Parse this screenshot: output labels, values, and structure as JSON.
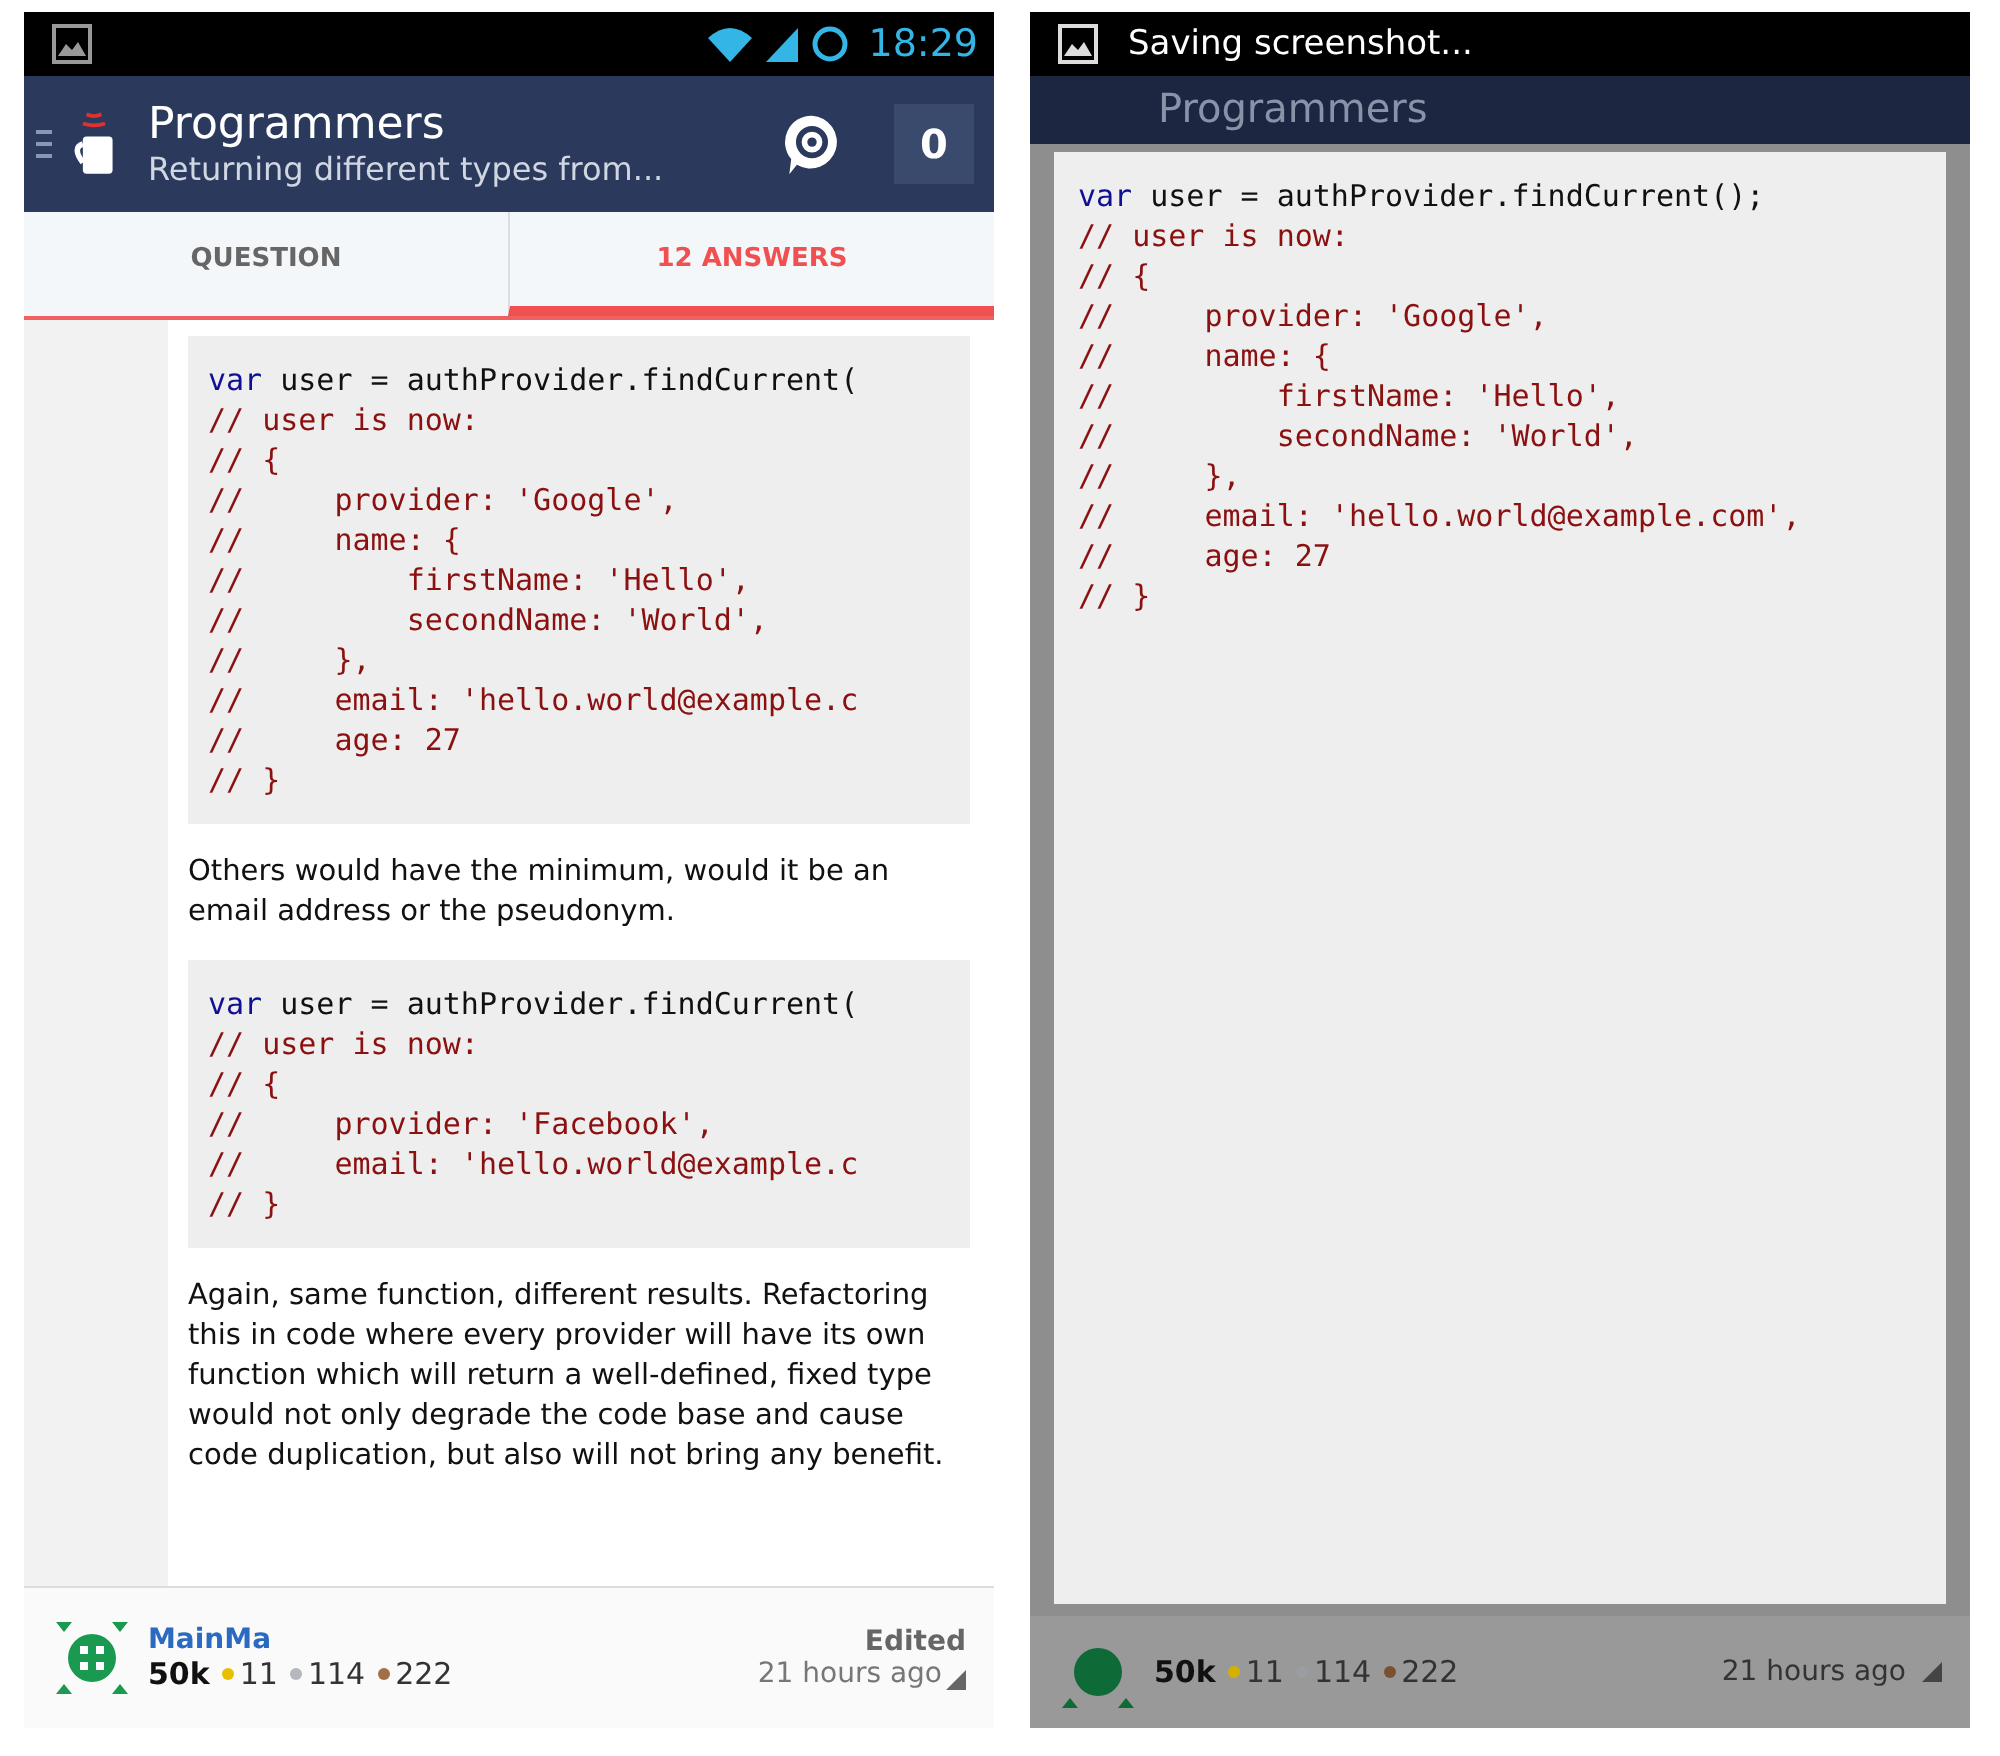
{
  "left_screen": {
    "status_bar": {
      "time": "18:29"
    },
    "header": {
      "title": "Programmers",
      "subtitle": "Returning different types from...",
      "count": "0"
    },
    "tabs": [
      {
        "label": "QUESTION",
        "selected": false
      },
      {
        "label": "12 ANSWERS",
        "selected": true
      }
    ],
    "content": [
      {
        "kind": "code",
        "lines": [
          [
            {
              "kind": "keyword",
              "text": "var"
            },
            {
              "kind": "plain",
              "text": " user = authProvider.findCurrent("
            }
          ],
          [
            {
              "kind": "comment",
              "text": "// user is now:"
            }
          ],
          [
            {
              "kind": "comment",
              "text": "// {"
            }
          ],
          [
            {
              "kind": "comment",
              "text": "//     provider: 'Google',"
            }
          ],
          [
            {
              "kind": "comment",
              "text": "//     name: {"
            }
          ],
          [
            {
              "kind": "comment",
              "text": "//         firstName: 'Hello',"
            }
          ],
          [
            {
              "kind": "comment",
              "text": "//         secondName: 'World',"
            }
          ],
          [
            {
              "kind": "comment",
              "text": "//     },"
            }
          ],
          [
            {
              "kind": "comment",
              "text": "//     email: 'hello.world@example.c"
            }
          ],
          [
            {
              "kind": "comment",
              "text": "//     age: 27"
            }
          ],
          [
            {
              "kind": "comment",
              "text": "// }"
            }
          ]
        ]
      },
      {
        "kind": "text",
        "text": "Others would have the minimum, would it be an email address or the pseudonym."
      },
      {
        "kind": "code",
        "lines": [
          [
            {
              "kind": "keyword",
              "text": "var"
            },
            {
              "kind": "plain",
              "text": " user = authProvider.findCurrent("
            }
          ],
          [
            {
              "kind": "comment",
              "text": "// user is now:"
            }
          ],
          [
            {
              "kind": "comment",
              "text": "// {"
            }
          ],
          [
            {
              "kind": "comment",
              "text": "//     provider: 'Facebook',"
            }
          ],
          [
            {
              "kind": "comment",
              "text": "//     email: 'hello.world@example.c"
            }
          ],
          [
            {
              "kind": "comment",
              "text": "// }"
            }
          ]
        ]
      },
      {
        "kind": "text",
        "text": "Again, same function, different results. Refactoring this in code where every provider will have its own function which will return a well-defined, fixed type would not only degrade the code base and cause code duplication, but also will not bring any benefit."
      }
    ],
    "footer": {
      "user": "MainMa",
      "reputation": "50k",
      "badges": [
        {
          "color": "#e6c000",
          "count": "11"
        },
        {
          "color": "#b4b8bc",
          "count": "114"
        },
        {
          "color": "#a0704a",
          "count": "222"
        }
      ],
      "edited": "Edited",
      "time": "21 hours ago"
    }
  },
  "right_screen": {
    "status_bar": {
      "notification": "Saving screenshot..."
    },
    "header": {
      "title": "Programmers"
    },
    "screenshot_preview": {
      "lines": [
        [
          {
            "kind": "keyword",
            "text": "var"
          },
          {
            "kind": "plain",
            "text": " user = authProvider.findCurrent();"
          }
        ],
        [
          {
            "kind": "comment",
            "text": "// user is now:"
          }
        ],
        [
          {
            "kind": "comment",
            "text": "// {"
          }
        ],
        [
          {
            "kind": "comment",
            "text": "//     provider: 'Google',"
          }
        ],
        [
          {
            "kind": "comment",
            "text": "//     name: {"
          }
        ],
        [
          {
            "kind": "comment",
            "text": "//         firstName: 'Hello',"
          }
        ],
        [
          {
            "kind": "comment",
            "text": "//         secondName: 'World',"
          }
        ],
        [
          {
            "kind": "comment",
            "text": "//     },"
          }
        ],
        [
          {
            "kind": "comment",
            "text": "//     email: 'hello.world@example.com',"
          }
        ],
        [
          {
            "kind": "comment",
            "text": "//     age: 27"
          }
        ],
        [
          {
            "kind": "comment",
            "text": "// }"
          }
        ]
      ]
    },
    "footer": {
      "reputation": "50k",
      "badges": [
        {
          "color": "#d4b000",
          "count": "11"
        },
        {
          "color": "#9a9ea2",
          "count": "114"
        },
        {
          "color": "#7a5030",
          "count": "222"
        }
      ],
      "time": "21 hours ago"
    }
  }
}
